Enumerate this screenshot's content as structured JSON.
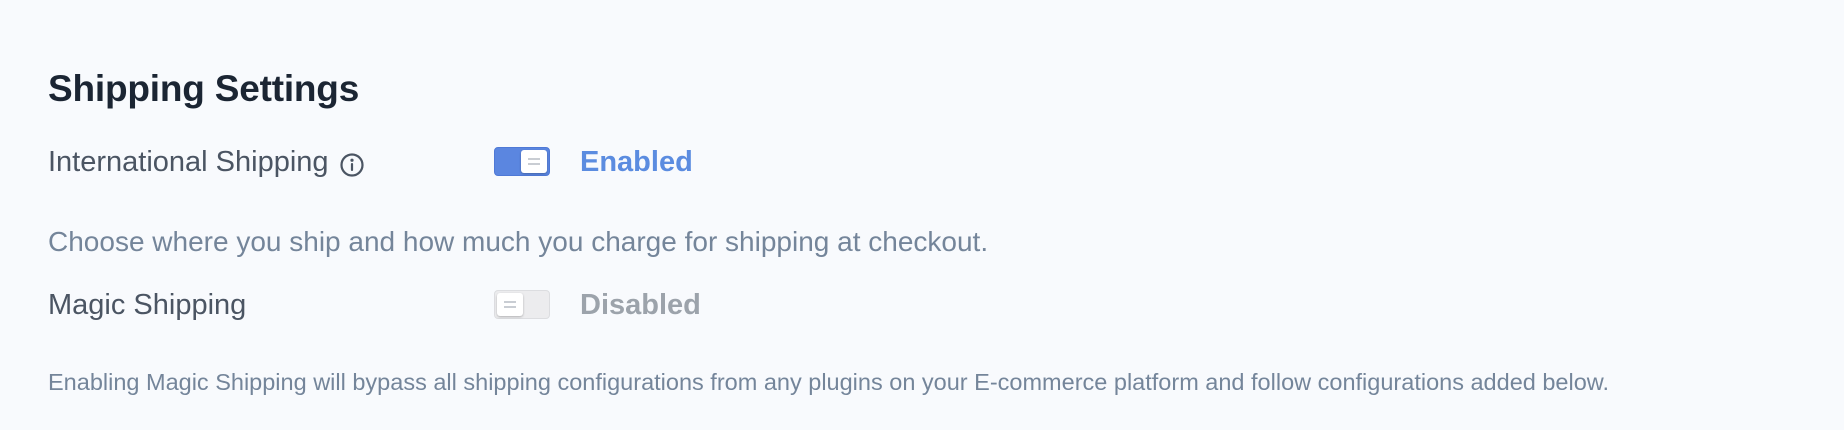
{
  "section": {
    "title": "Shipping Settings"
  },
  "international_shipping": {
    "label": "International Shipping",
    "toggle_state": "on",
    "status": "Enabled",
    "info_icon": "info-circle-icon"
  },
  "international_description": "Choose where you ship and how much you charge for shipping at checkout.",
  "magic_shipping": {
    "label": "Magic Shipping",
    "toggle_state": "off",
    "status": "Disabled"
  },
  "magic_description": "Enabling Magic Shipping will bypass all shipping configurations from any plugins on your E-commerce platform and follow configurations added below.",
  "colors": {
    "enabled": "#5b8ce0",
    "disabled": "#9ca3ab",
    "background": "#f8fafd",
    "heading": "#1b2533"
  }
}
